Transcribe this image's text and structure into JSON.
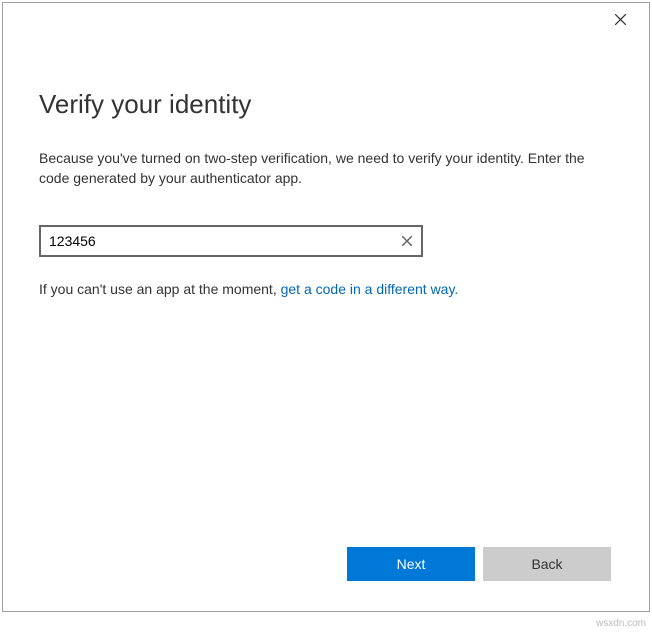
{
  "dialog": {
    "title": "Verify your identity",
    "description": "Because you've turned on two-step verification, we need to verify your identity. Enter the code generated by your authenticator app.",
    "code_input": {
      "value": "123456",
      "placeholder": ""
    },
    "helper_prefix": "If you can't use an app at the moment, ",
    "helper_link": "get a code in a different way."
  },
  "buttons": {
    "next": "Next",
    "back": "Back"
  },
  "watermark": "wsxdn.com",
  "colors": {
    "primary": "#0078d7",
    "link": "#0067b8",
    "secondary_bg": "#cccccc"
  }
}
